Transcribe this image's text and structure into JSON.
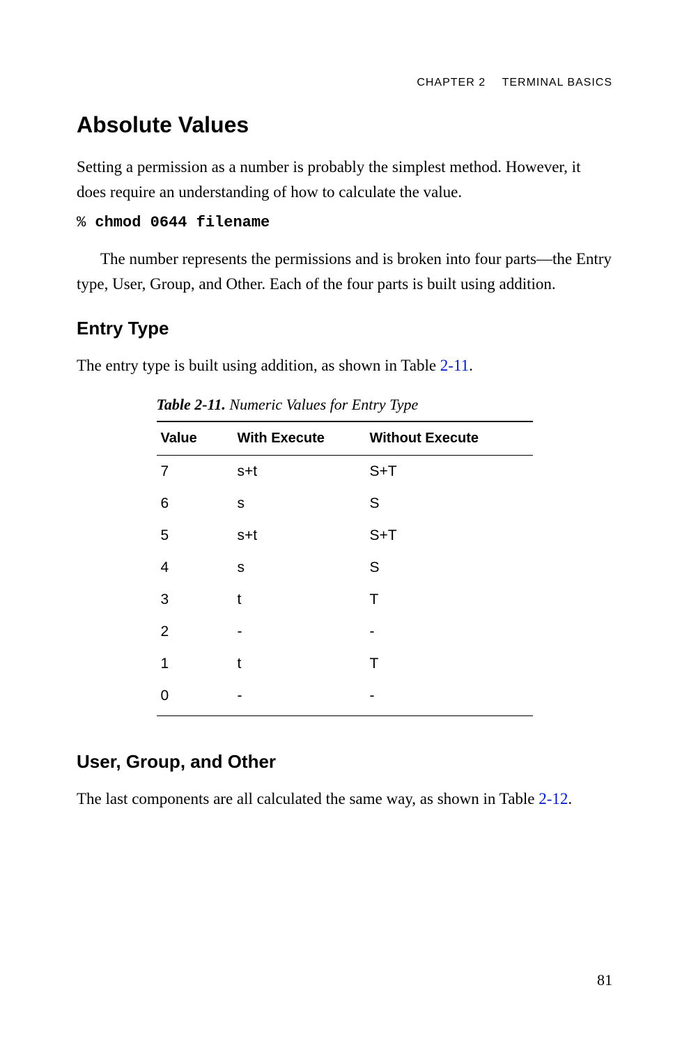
{
  "header": {
    "chapter": "CHAPTER 2",
    "title": "TERMINAL BASICS"
  },
  "section1": {
    "heading": "Absolute Values",
    "para1": "Setting a permission as a number is probably the simplest method. However, it does require an understanding of how to calculate the value.",
    "prompt": "% ",
    "command": "chmod 0644 filename",
    "para2": "The number represents the permissions and is broken into four parts—the Entry type, User, Group, and Other. Each of the four parts is built using addition."
  },
  "section2": {
    "heading": "Entry Type",
    "para_prefix": "The entry type is built using addition, as shown in Table ",
    "link": "2-11",
    "para_suffix": "."
  },
  "table": {
    "label": "Table 2-11.",
    "title": "  Numeric Values for Entry Type",
    "headers": {
      "value": "Value",
      "with": "With Execute",
      "without": "Without Execute"
    },
    "rows": [
      {
        "value": "7",
        "with": "s+t",
        "without": "S+T"
      },
      {
        "value": "6",
        "with": "s",
        "without": "S"
      },
      {
        "value": "5",
        "with": "s+t",
        "without": "S+T"
      },
      {
        "value": "4",
        "with": "s",
        "without": "S"
      },
      {
        "value": "3",
        "with": "t",
        "without": "T"
      },
      {
        "value": "2",
        "with": "-",
        "without": "-"
      },
      {
        "value": "1",
        "with": "t",
        "without": "T"
      },
      {
        "value": "0",
        "with": "-",
        "without": "-"
      }
    ]
  },
  "section3": {
    "heading": "User, Group, and Other",
    "para_prefix": "The last components are all calculated the same way, as shown in Table ",
    "link": "2-12",
    "para_suffix": "."
  },
  "page_number": "81"
}
